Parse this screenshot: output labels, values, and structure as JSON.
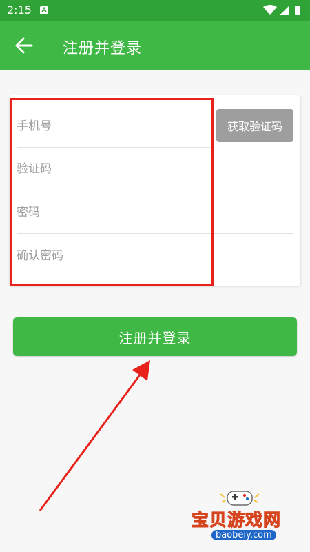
{
  "status_bar": {
    "time": "2:15",
    "notification_icon": "A"
  },
  "app_bar": {
    "title": "注册并登录",
    "back_icon": "arrow-left"
  },
  "form": {
    "phone_placeholder": "手机号",
    "code_placeholder": "验证码",
    "password_placeholder": "密码",
    "confirm_placeholder": "确认密码",
    "get_code_label": "获取验证码"
  },
  "submit_label": "注册并登录",
  "watermark": {
    "name": "宝贝游戏网",
    "url": "baobeiy.com"
  },
  "colors": {
    "primary": "#40b846",
    "status_bar": "#2fa335",
    "annotation": "#e8221b",
    "disabled_button": "#9e9e9e"
  }
}
